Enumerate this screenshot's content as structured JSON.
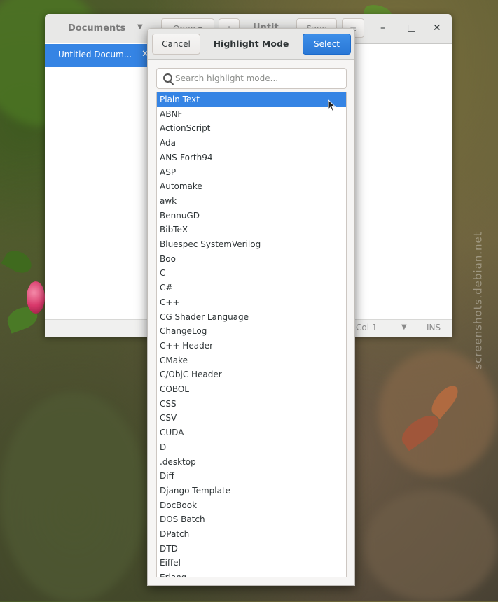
{
  "watermark": "screenshots.debian.net",
  "gedit": {
    "documents_label": "Documents",
    "open_label": "Open",
    "title_fragment": "Untit",
    "save_label": "Save",
    "doc_tab_label": "Untitled Docum...",
    "status": {
      "col": "Col 1",
      "mode": "INS"
    }
  },
  "dialog": {
    "title": "Highlight Mode",
    "cancel_label": "Cancel",
    "select_label": "Select",
    "search_placeholder": "Search highlight mode...",
    "selected_index": 0,
    "modes": [
      "Plain Text",
      "ABNF",
      "ActionScript",
      "Ada",
      "ANS-Forth94",
      "ASP",
      "Automake",
      "awk",
      "BennuGD",
      "BibTeX",
      "Bluespec SystemVerilog",
      "Boo",
      "C",
      "C#",
      "C++",
      "CG Shader Language",
      "ChangeLog",
      "C++ Header",
      "CMake",
      "C/ObjC Header",
      "COBOL",
      "CSS",
      "CSV",
      "CUDA",
      "D",
      ".desktop",
      "Diff",
      "Django Template",
      "DocBook",
      "DOS Batch",
      "DPatch",
      "DTD",
      "Eiffel",
      "Erlang"
    ]
  }
}
